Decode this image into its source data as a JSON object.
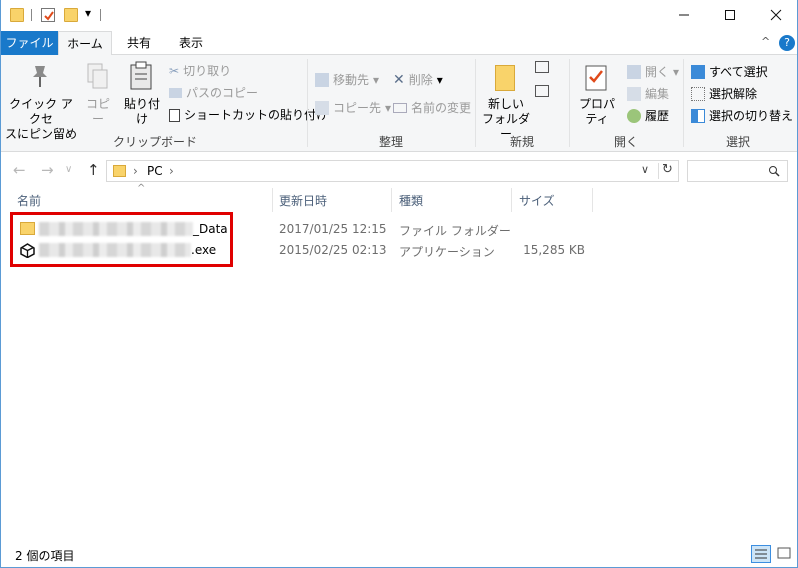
{
  "window": {
    "title": "PC",
    "minimize_glyph": "—",
    "maximize_glyph": "☐",
    "close_glyph": "✕"
  },
  "tabs": {
    "file": "ファイル",
    "home": "ホーム",
    "share": "共有",
    "view": "表示"
  },
  "ribbon": {
    "clipboard": {
      "quick_access": "クイック アクセ",
      "quick_access_2": "スにピン留め",
      "copy": "コピー",
      "paste": "貼り付け",
      "cut": "切り取り",
      "copy_path": "パスのコピー",
      "paste_shortcut": "ショートカットの貼り付け",
      "label": "クリップボード"
    },
    "organize": {
      "move_to": "移動先",
      "copy_to": "コピー先",
      "delete": "削除",
      "rename": "名前の変更",
      "label": "整理"
    },
    "new": {
      "new_folder_1": "新しい",
      "new_folder_2": "フォルダー",
      "label": "新規"
    },
    "open": {
      "properties": "プロパティ",
      "open": "開く",
      "edit": "編集",
      "history": "履歴",
      "label": "開く"
    },
    "select": {
      "select_all": "すべて選択",
      "select_none": "選択解除",
      "invert": "選択の切り替え",
      "label": "選択"
    }
  },
  "address": {
    "location": "PC",
    "separator": "›"
  },
  "columns": {
    "name": "名前",
    "date": "更新日時",
    "type": "種類",
    "size": "サイズ"
  },
  "files": [
    {
      "name_suffix": "_Data",
      "date": "2017/01/25 12:15",
      "type": "ファイル フォルダー",
      "size": "",
      "icon": "folder-icon"
    },
    {
      "name_suffix": ".exe",
      "date": "2015/02/25 02:13",
      "type": "アプリケーション",
      "size": "15,285 KB",
      "icon": "unity-icon"
    }
  ],
  "status": {
    "count": "2 個の項目"
  },
  "colors": {
    "accent": "#1979ca",
    "highlight_box": "#e00000",
    "folder": "#f9d36a"
  }
}
